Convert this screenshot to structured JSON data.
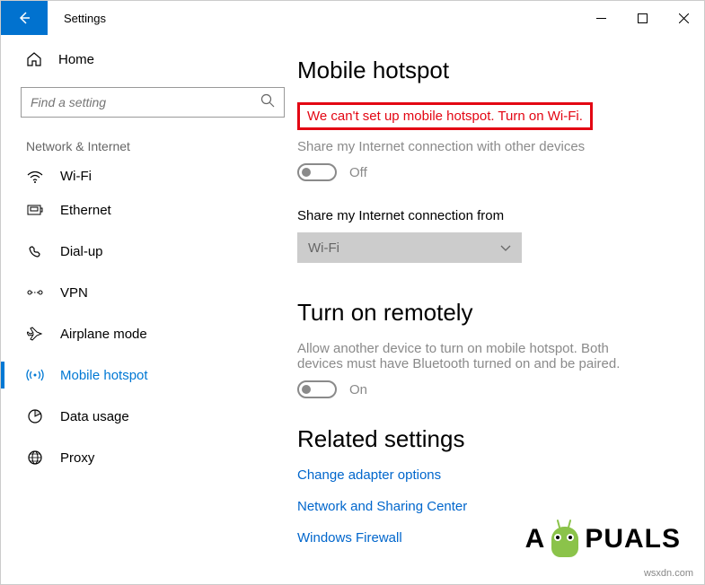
{
  "window": {
    "title": "Settings"
  },
  "sidebar": {
    "home_label": "Home",
    "search_placeholder": "Find a setting",
    "category_label": "Network & Internet",
    "items": [
      {
        "label": "Wi-Fi"
      },
      {
        "label": "Ethernet"
      },
      {
        "label": "Dial-up"
      },
      {
        "label": "VPN"
      },
      {
        "label": "Airplane mode"
      },
      {
        "label": "Mobile hotspot"
      },
      {
        "label": "Data usage"
      },
      {
        "label": "Proxy"
      }
    ]
  },
  "main": {
    "page_title": "Mobile hotspot",
    "error_message": "We can't set up mobile hotspot. Turn on Wi-Fi.",
    "share_label": "Share my Internet connection with other devices",
    "share_toggle_state": "Off",
    "share_from_label": "Share my Internet connection from",
    "share_from_value": "Wi-Fi",
    "remote_heading": "Turn on remotely",
    "remote_desc": "Allow another device to turn on mobile hotspot. Both devices must have Bluetooth turned on and be paired.",
    "remote_toggle_state": "On",
    "related_heading": "Related settings",
    "links": [
      "Change adapter options",
      "Network and Sharing Center",
      "Windows Firewall"
    ]
  },
  "watermark": {
    "text_a": "A",
    "text_b": "PUALS",
    "url": "wsxdn.com"
  }
}
